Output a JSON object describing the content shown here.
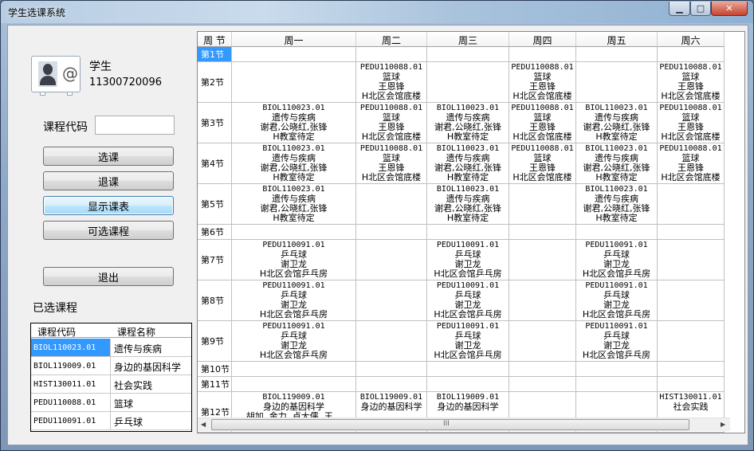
{
  "window": {
    "title": "学生选课系统",
    "min": "▁",
    "max": "□",
    "close": "✕"
  },
  "user": {
    "role": "学生",
    "id": "11300720096"
  },
  "form": {
    "course_code_label": "课程代码",
    "course_code_value": ""
  },
  "buttons": {
    "select": "选课",
    "drop": "退课",
    "show_table": "显示课表",
    "available": "可选课程",
    "exit": "退出"
  },
  "selected": {
    "title": "已选课程",
    "headers": [
      "课程代码",
      "课程名称"
    ],
    "rows": [
      {
        "code": "BIOL110023.01",
        "name": "遗传与疾病"
      },
      {
        "code": "BIOL119009.01",
        "name": "身边的基因科学"
      },
      {
        "code": "HIST130011.01",
        "name": "社会实践"
      },
      {
        "code": "PEDU110088.01",
        "name": "篮球"
      },
      {
        "code": "PEDU110091.01",
        "name": "乒乓球"
      }
    ]
  },
  "timetable": {
    "corner": "周 节",
    "days": [
      "周一",
      "周二",
      "周三",
      "周四",
      "周五",
      "周六"
    ],
    "periods": [
      "第1节",
      "第2节",
      "第3节",
      "第4节",
      "第5节",
      "第6节",
      "第7节",
      "第8节",
      "第9节",
      "第10节",
      "第11节",
      "第12节"
    ],
    "courses": {
      "bio": [
        "BIOL110023.01",
        "遗传与疾病",
        "谢君,公晓红,张锋",
        "H教室待定"
      ],
      "bball": [
        "PEDU110088.01",
        "篮球",
        "王恩锋",
        "H北区会馆底楼"
      ],
      "pp": [
        "PEDU110091.01",
        "乒乓球",
        "谢卫龙",
        "H北区会馆乒乓房"
      ],
      "gene": [
        "BIOL119009.01",
        "身边的基因科学",
        "胡加, 金力, 卢大儒, 王...",
        ""
      ],
      "gene2": [
        "BIOL119009.01",
        "身边的基因科学",
        "",
        ""
      ],
      "hist": [
        "HIST130011.01",
        "社会实践",
        "",
        ""
      ]
    },
    "schedule": [
      [
        "",
        "",
        "",
        "",
        "",
        ""
      ],
      [
        "",
        "bball",
        "",
        "bball",
        "",
        "bball"
      ],
      [
        "bio",
        "bball",
        "bio",
        "bball",
        "bio",
        "bball"
      ],
      [
        "bio",
        "bball",
        "bio",
        "bball",
        "bio",
        "bball"
      ],
      [
        "bio",
        "",
        "bio",
        "",
        "bio",
        ""
      ],
      [
        "",
        "",
        "",
        "",
        "",
        ""
      ],
      [
        "pp",
        "",
        "pp",
        "",
        "pp",
        ""
      ],
      [
        "pp",
        "",
        "pp",
        "",
        "pp",
        ""
      ],
      [
        "pp",
        "",
        "pp",
        "",
        "pp",
        ""
      ],
      [
        "",
        "",
        "",
        "",
        "",
        ""
      ],
      [
        "",
        "",
        "",
        "",
        "",
        ""
      ],
      [
        "gene",
        "gene2",
        "gene2",
        "",
        "",
        "hist"
      ]
    ]
  },
  "scroll": {
    "vertical_thumb": "≡",
    "horizontal_thumb": "III"
  }
}
